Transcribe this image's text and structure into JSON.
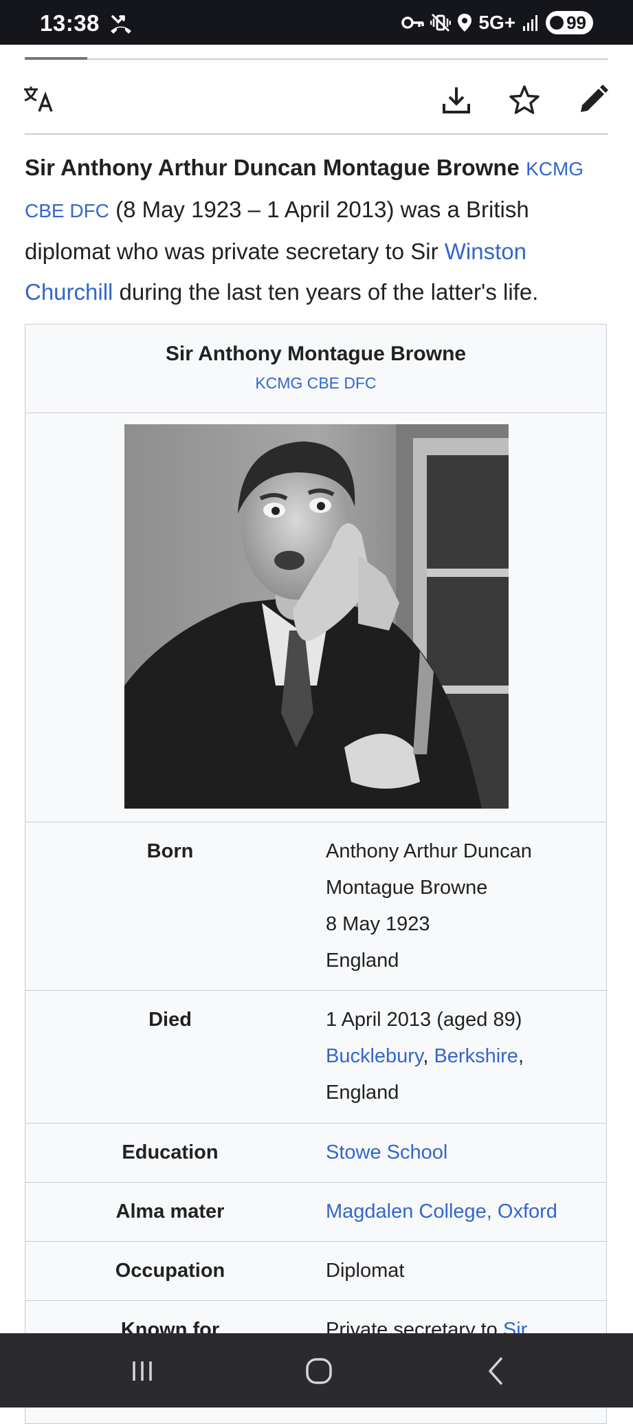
{
  "status_bar": {
    "time": "13:38",
    "network": "5G+",
    "battery": "99",
    "icons": [
      "missed-call-icon",
      "key-icon",
      "vibrate-icon",
      "location-icon",
      "signal-icon",
      "battery-icon"
    ]
  },
  "toolbar": {
    "icons": [
      "translate-icon",
      "download-icon",
      "star-icon",
      "edit-pencil-icon"
    ]
  },
  "lead": {
    "name": "Sir Anthony Arthur Duncan Montague Browne",
    "postnominals": "KCMG CBE DFC",
    "text_1": " (8 May 1923 – 1 April 2013) was a British diplomat who was private secretary to Sir ",
    "link_churchill": "Winston Churchill",
    "text_2": " during the last ten years of the latter's life."
  },
  "infobox": {
    "title": "Sir Anthony Montague Browne",
    "honours": "KCMG CBE DFC",
    "rows": [
      {
        "label": "Born",
        "lines": [
          "Anthony Arthur Duncan",
          "Montague Browne",
          "8 May 1923",
          "England"
        ]
      },
      {
        "label": "Died",
        "line_1": "1 April 2013 (aged 89)",
        "link_1": "Bucklebury",
        "sep": ", ",
        "link_2": "Berkshire",
        "trail": ",",
        "line_3": "England"
      },
      {
        "label": "Education",
        "value": "Stowe School"
      },
      {
        "label": "Alma mater",
        "value": "Magdalen College, Oxford"
      },
      {
        "label": "Occupation",
        "value": "Diplomat"
      },
      {
        "label": "Known for",
        "value": "Private secretary to ",
        "link": "Sir"
      }
    ]
  },
  "colors": {
    "link": "#3366cc",
    "text": "#202122",
    "infobox_bg": "#f8f9fa",
    "border": "#c8ccd1",
    "status_bar": "#15161b",
    "nav_bar": "#2b2b2f"
  },
  "nav_bar": {
    "icons": [
      "recent-apps-icon",
      "home-icon",
      "back-icon"
    ]
  }
}
